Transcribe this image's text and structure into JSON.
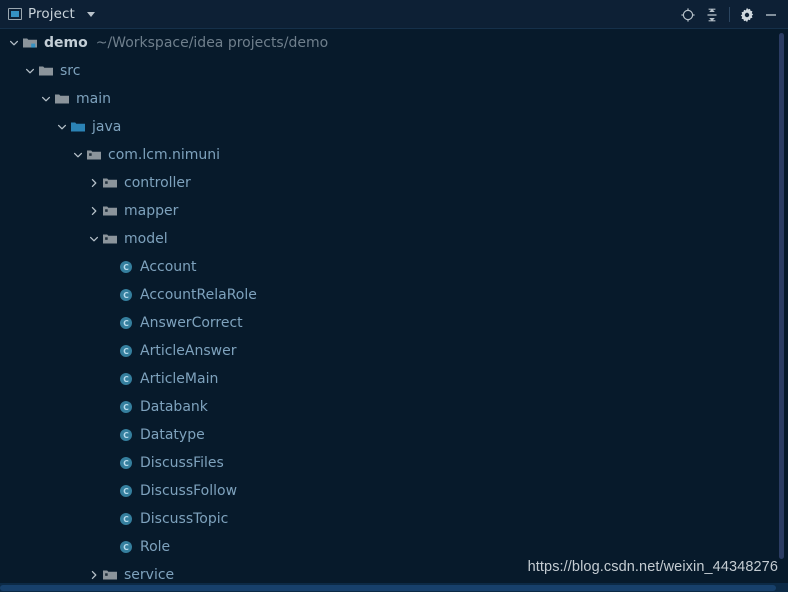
{
  "window": {
    "title": "Project",
    "title_icon": "project-icon",
    "dropdown_icon": "chevron-down-icon"
  },
  "header_actions": [
    {
      "name": "locate-icon",
      "label": "Select Opened File"
    },
    {
      "name": "collapse-all-icon",
      "label": "Collapse All"
    },
    {
      "name": "gear-icon",
      "label": "Settings"
    },
    {
      "name": "minimize-icon",
      "label": "Hide"
    }
  ],
  "tree": {
    "rows": [
      {
        "depth": 0,
        "twisty": "expanded",
        "icon": "module-icon",
        "name": "demo",
        "bold": true,
        "path": "~/Workspace/idea projects/demo"
      },
      {
        "depth": 1,
        "twisty": "expanded",
        "icon": "folder-icon",
        "name": "src"
      },
      {
        "depth": 2,
        "twisty": "expanded",
        "icon": "folder-icon",
        "name": "main"
      },
      {
        "depth": 3,
        "twisty": "expanded",
        "icon": "source-root-icon",
        "name": "java"
      },
      {
        "depth": 4,
        "twisty": "expanded",
        "icon": "package-icon",
        "name": "com.lcm.nimuni"
      },
      {
        "depth": 5,
        "twisty": "collapsed",
        "icon": "package-icon",
        "name": "controller"
      },
      {
        "depth": 5,
        "twisty": "collapsed",
        "icon": "package-icon",
        "name": "mapper"
      },
      {
        "depth": 5,
        "twisty": "expanded",
        "icon": "package-icon",
        "name": "model"
      },
      {
        "depth": 6,
        "twisty": "none",
        "icon": "class-icon",
        "name": "Account"
      },
      {
        "depth": 6,
        "twisty": "none",
        "icon": "class-icon",
        "name": "AccountRelaRole"
      },
      {
        "depth": 6,
        "twisty": "none",
        "icon": "class-icon",
        "name": "AnswerCorrect"
      },
      {
        "depth": 6,
        "twisty": "none",
        "icon": "class-icon",
        "name": "ArticleAnswer"
      },
      {
        "depth": 6,
        "twisty": "none",
        "icon": "class-icon",
        "name": "ArticleMain"
      },
      {
        "depth": 6,
        "twisty": "none",
        "icon": "class-icon",
        "name": "Databank"
      },
      {
        "depth": 6,
        "twisty": "none",
        "icon": "class-icon",
        "name": "Datatype"
      },
      {
        "depth": 6,
        "twisty": "none",
        "icon": "class-icon",
        "name": "DiscussFiles"
      },
      {
        "depth": 6,
        "twisty": "none",
        "icon": "class-icon",
        "name": "DiscussFollow"
      },
      {
        "depth": 6,
        "twisty": "none",
        "icon": "class-icon",
        "name": "DiscussTopic"
      },
      {
        "depth": 6,
        "twisty": "none",
        "icon": "class-icon",
        "name": "Role"
      },
      {
        "depth": 5,
        "twisty": "collapsed",
        "icon": "package-icon",
        "name": "service"
      }
    ]
  },
  "scrollbars": {
    "vertical_thumb": "vertical-scrollbar-thumb",
    "horizontal_thumb": "horizontal-scrollbar-thumb"
  },
  "watermark": {
    "text": "https://blog.csdn.net/weixin_44348276"
  },
  "colors": {
    "background": "#071a2b",
    "header_background": "#0d2035",
    "tree_text": "#7ea2bd",
    "path_text": "#6f7f8c",
    "accent": "#3592c4",
    "class_icon": "#3c7c9e",
    "folder_icon": "#8b949b"
  }
}
